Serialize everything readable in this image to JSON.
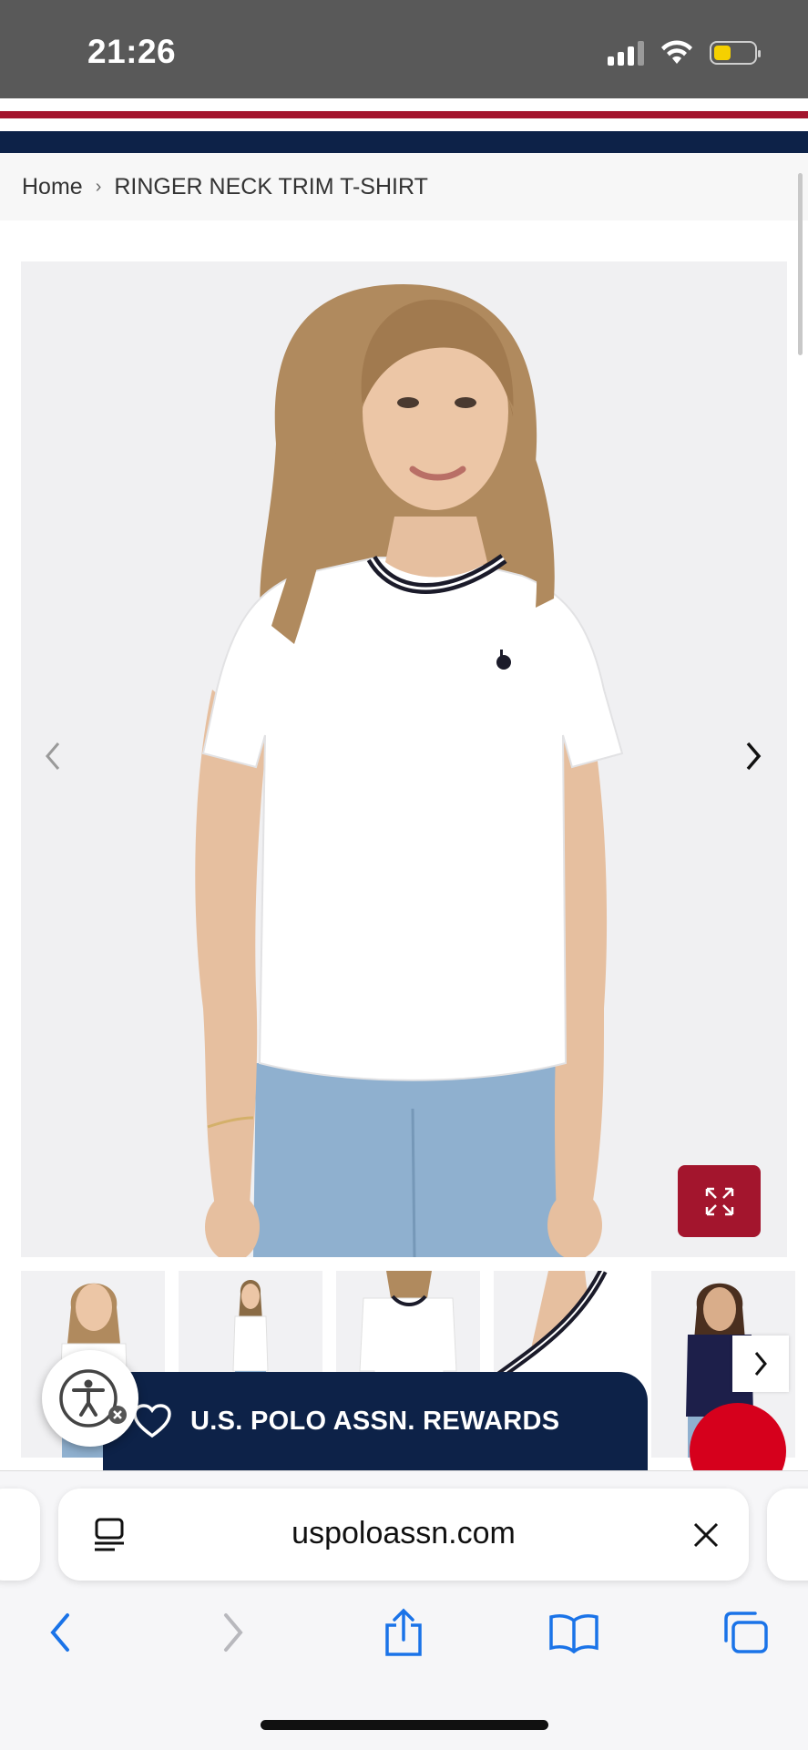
{
  "status_bar": {
    "time": "21:26",
    "icons": [
      "signal-icon",
      "wifi-icon",
      "battery-icon"
    ],
    "battery_color": "#f5d000"
  },
  "brand": {
    "red": "#a3152d",
    "navy": "#0d2248"
  },
  "breadcrumb": {
    "home_label": "Home",
    "separator": "›",
    "current_label": "RINGER NECK TRIM T-SHIRT"
  },
  "gallery": {
    "image_alt": "Woman wearing white ringer neck trim t-shirt with navy and white collar",
    "thumbnails": [
      "front-model-view",
      "front-full-view",
      "back-view",
      "collar-detail-view",
      "navy-color-variant"
    ]
  },
  "rewards": {
    "label": "U.S. POLO ASSN. REWARDS"
  },
  "browser": {
    "url": "uspoloassn.com"
  }
}
